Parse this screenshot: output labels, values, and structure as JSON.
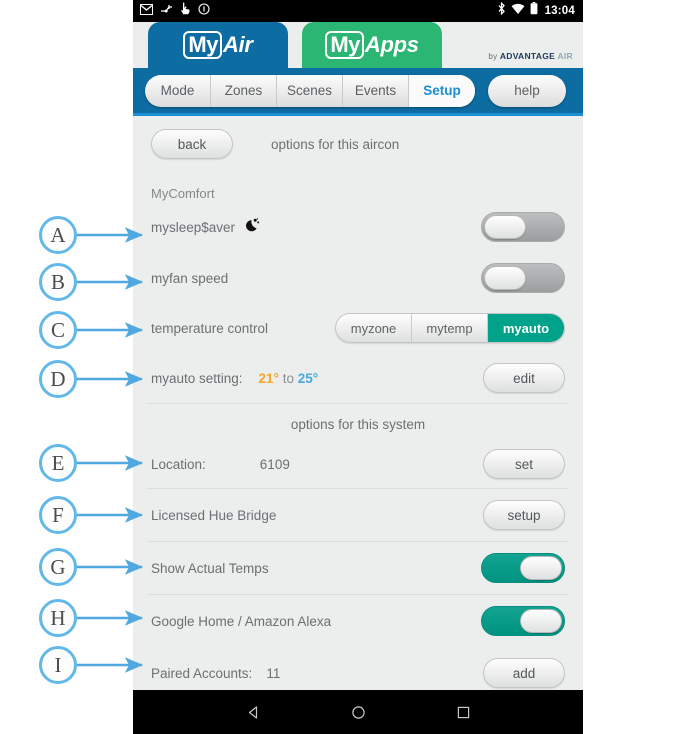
{
  "statusbar": {
    "icons_left": [
      "mail-icon",
      "usb-debug-icon",
      "pointer-icon",
      "info-icon"
    ],
    "icons_right": [
      "bluetooth-icon",
      "wifi-icon",
      "battery-icon"
    ],
    "clock": "13:04"
  },
  "brand": {
    "myair_my": "My",
    "myair_tail": "Air",
    "myapps_my": "My",
    "myapps_tail": "Apps",
    "byline_pre": "by",
    "byline_adv": "ADVANTAGE",
    "byline_air": "AIR"
  },
  "nav": {
    "tabs": [
      {
        "label": "Mode",
        "active": false
      },
      {
        "label": "Zones",
        "active": false
      },
      {
        "label": "Scenes",
        "active": false
      },
      {
        "label": "Events",
        "active": false
      },
      {
        "label": "Setup",
        "active": true
      }
    ],
    "help_label": "help"
  },
  "header": {
    "back_label": "back",
    "subtitle": "options for this aircon"
  },
  "mycomfort": {
    "section_label": "MyComfort",
    "rows": [
      {
        "label": "mysleep$aver",
        "icon": "crescent-moon-icon",
        "toggle": "off"
      },
      {
        "label": "myfan speed",
        "toggle": "off"
      }
    ],
    "temperature_control": {
      "label": "temperature control",
      "options": [
        {
          "label": "myzone",
          "selected": false
        },
        {
          "label": "mytemp",
          "selected": false
        },
        {
          "label": "myauto",
          "selected": true
        }
      ]
    },
    "myauto_setting": {
      "label": "myauto setting:",
      "low": "21°",
      "to": "to",
      "high": "25°",
      "button": "edit"
    }
  },
  "system": {
    "section_label": "options for this system",
    "rows": [
      {
        "label": "Location:",
        "value": "6109",
        "button": "set"
      },
      {
        "label": "Licensed Hue Bridge",
        "value": "",
        "button": "setup"
      },
      {
        "label": "Show Actual Temps",
        "toggle": "on"
      },
      {
        "label": "Google Home / Amazon Alexa",
        "toggle": "on"
      },
      {
        "label": "Paired Accounts:",
        "value": "11",
        "button": "add"
      }
    ]
  },
  "androidnav": {
    "back": "back-triangle-icon",
    "home": "home-circle-icon",
    "recents": "recents-square-icon"
  },
  "annotations": [
    {
      "letter": "A",
      "target": "mysleep$aver"
    },
    {
      "letter": "B",
      "target": "myfan speed"
    },
    {
      "letter": "C",
      "target": "temperature control"
    },
    {
      "letter": "D",
      "target": "myauto setting"
    },
    {
      "letter": "E",
      "target": "Location"
    },
    {
      "letter": "F",
      "target": "Licensed Hue Bridge"
    },
    {
      "letter": "G",
      "target": "Show Actual Temps"
    },
    {
      "letter": "H",
      "target": "Google Home / Amazon Alexa"
    },
    {
      "letter": "I",
      "target": "Paired Accounts"
    }
  ],
  "colors": {
    "brand_blue": "#0d6ca2",
    "brand_green": "#2bb673",
    "accent_teal": "#00a28a",
    "link_blue": "#1a8fd1",
    "annotation_blue": "#62b8e8",
    "temp_low": "#f5a623",
    "temp_high": "#4aa8e0",
    "page_bg": "#eceded"
  }
}
